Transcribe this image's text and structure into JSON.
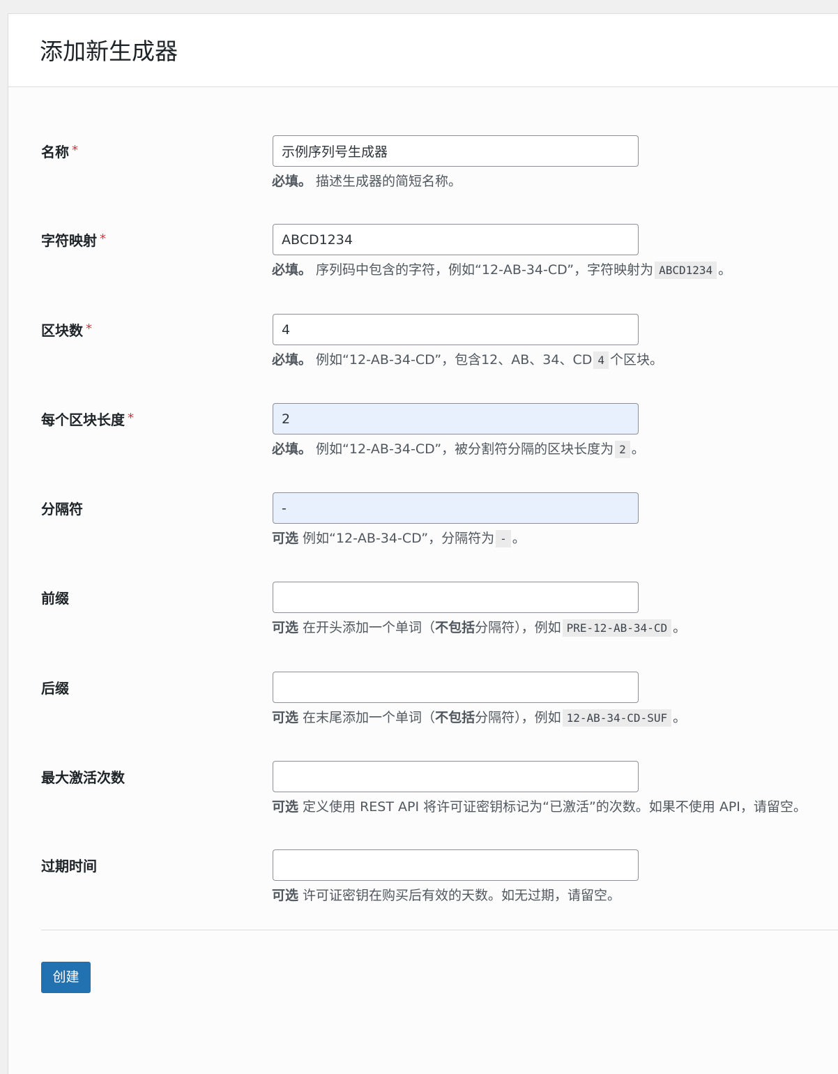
{
  "page": {
    "title": "添加新生成器"
  },
  "form": {
    "name": {
      "label": "名称",
      "required_mark": "*",
      "value": "示例序列号生成器",
      "desc_tag": "必填。",
      "desc_text": " 描述生成器的简短名称。"
    },
    "charset": {
      "label": "字符映射",
      "required_mark": "*",
      "value": "ABCD1234",
      "desc_tag": "必填。",
      "desc_text": " 序列码中包含的字符，例如“12-AB-34-CD”，字符映射为",
      "desc_code": "ABCD1234",
      "desc_after": "。"
    },
    "chunks": {
      "label": "区块数",
      "required_mark": "*",
      "value": "4",
      "desc_tag": "必填。",
      "desc_text": " 例如“12-AB-34-CD”，包含12、AB、34、CD",
      "desc_code": "4",
      "desc_after": "个区块。"
    },
    "chunk_length": {
      "label": "每个区块长度",
      "required_mark": "*",
      "value": "2",
      "desc_tag": "必填。",
      "desc_text": " 例如“12-AB-34-CD”，被分割符分隔的区块长度为",
      "desc_code": "2",
      "desc_after": "。"
    },
    "separator": {
      "label": "分隔符",
      "value": "-",
      "desc_tag": "可选",
      "desc_text": " 例如“12-AB-34-CD”，分隔符为",
      "desc_code": "-",
      "desc_after": "。"
    },
    "prefix": {
      "label": "前缀",
      "value": "",
      "desc_tag": "可选",
      "desc_text": " 在开头添加一个单词（",
      "desc_bold": "不包括",
      "desc_text2": "分隔符），例如",
      "desc_code": "PRE-12-AB-34-CD",
      "desc_after": "。"
    },
    "suffix": {
      "label": "后缀",
      "value": "",
      "desc_tag": "可选",
      "desc_text": " 在末尾添加一个单词（",
      "desc_bold": "不包括",
      "desc_text2": "分隔符），例如",
      "desc_code": "12-AB-34-CD-SUF",
      "desc_after": "。"
    },
    "max_activations": {
      "label": "最大激活次数",
      "value": "",
      "desc_tag": "可选",
      "desc_text": " 定义使用 REST API 将许可证密钥标记为“已激活”的次数。如果不使用 API，请留空。"
    },
    "expires_in": {
      "label": "过期时间",
      "value": "",
      "desc_tag": "可选",
      "desc_text": " 许可证密钥在购买后有效的天数。如无过期，请留空。"
    }
  },
  "actions": {
    "submit_label": "创建"
  },
  "colors": {
    "primary": "#2271b1",
    "required": "#d63638",
    "autofill": "#e8f0fe"
  }
}
